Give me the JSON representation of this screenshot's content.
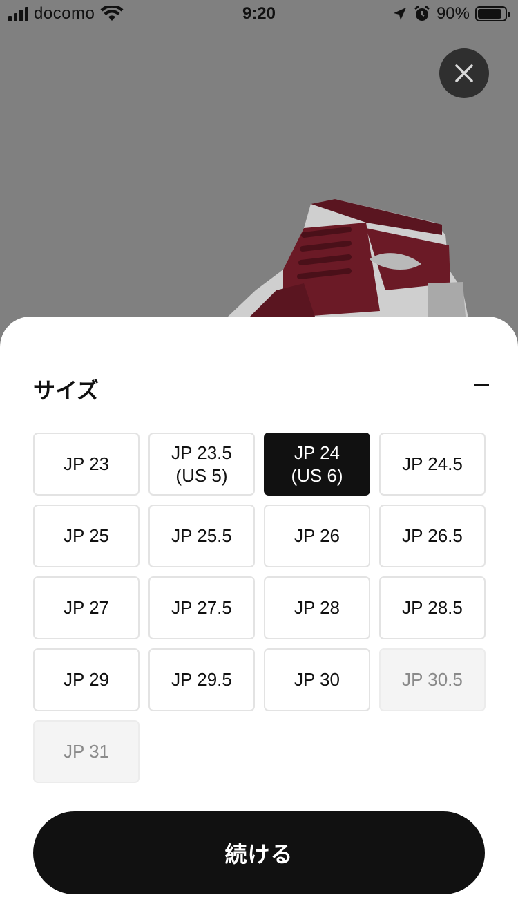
{
  "status_bar": {
    "carrier": "docomo",
    "time": "9:20",
    "battery_percent": "90%",
    "battery_level": 0.9,
    "icons": [
      "signal-icon",
      "wifi-icon",
      "location-arrow-icon",
      "alarm-icon",
      "battery-icon"
    ]
  },
  "overlay": {
    "close_icon": "close-icon",
    "product_image": "sneaker-image"
  },
  "sheet": {
    "title": "サイズ",
    "collapse_icon": "minus-icon",
    "sizes": [
      {
        "label": "JP 23",
        "state": "available"
      },
      {
        "label": "JP 23.5\n(US 5)",
        "state": "available"
      },
      {
        "label": "JP 24\n(US 6)",
        "state": "selected"
      },
      {
        "label": "JP 24.5",
        "state": "available"
      },
      {
        "label": "JP 25",
        "state": "available"
      },
      {
        "label": "JP 25.5",
        "state": "available"
      },
      {
        "label": "JP 26",
        "state": "available"
      },
      {
        "label": "JP 26.5",
        "state": "available"
      },
      {
        "label": "JP 27",
        "state": "available"
      },
      {
        "label": "JP 27.5",
        "state": "available"
      },
      {
        "label": "JP 28",
        "state": "available"
      },
      {
        "label": "JP 28.5",
        "state": "available"
      },
      {
        "label": "JP 29",
        "state": "available"
      },
      {
        "label": "JP 29.5",
        "state": "available"
      },
      {
        "label": "JP 30",
        "state": "available"
      },
      {
        "label": "JP 30.5",
        "state": "disabled"
      },
      {
        "label": "JP 31",
        "state": "disabled"
      }
    ],
    "continue_label": "続ける"
  },
  "colors": {
    "overlay": "#808080",
    "primary": "#111111",
    "disabled_bg": "#f4f4f4",
    "disabled_text": "#8a8a8a",
    "border": "#e3e3e3"
  }
}
